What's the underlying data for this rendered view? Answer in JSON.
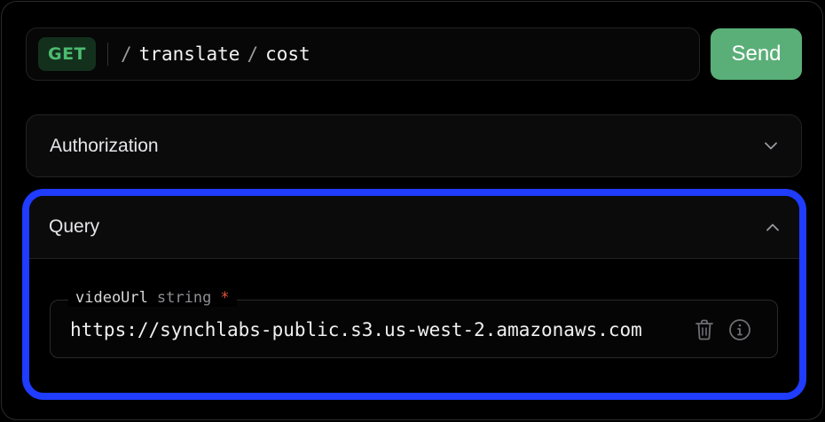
{
  "request": {
    "method": "GET",
    "path_segments": [
      "translate",
      "cost"
    ],
    "separator": "/",
    "send_label": "Send"
  },
  "authorization": {
    "title": "Authorization",
    "expanded": false
  },
  "query": {
    "title": "Query",
    "expanded": true,
    "param": {
      "name": "videoUrl",
      "type": "string",
      "required_marker": "*",
      "value": "https://synchlabs-public.s3.us-west-2.amazonaws.com"
    }
  },
  "colors": {
    "accent_highlight": "#1f3cff",
    "method_get": "#4dbb70",
    "send_button": "#5aaf78",
    "required": "#e5533d"
  },
  "icons": [
    "chevron-down-icon",
    "chevron-up-icon",
    "trash-icon",
    "info-icon"
  ]
}
